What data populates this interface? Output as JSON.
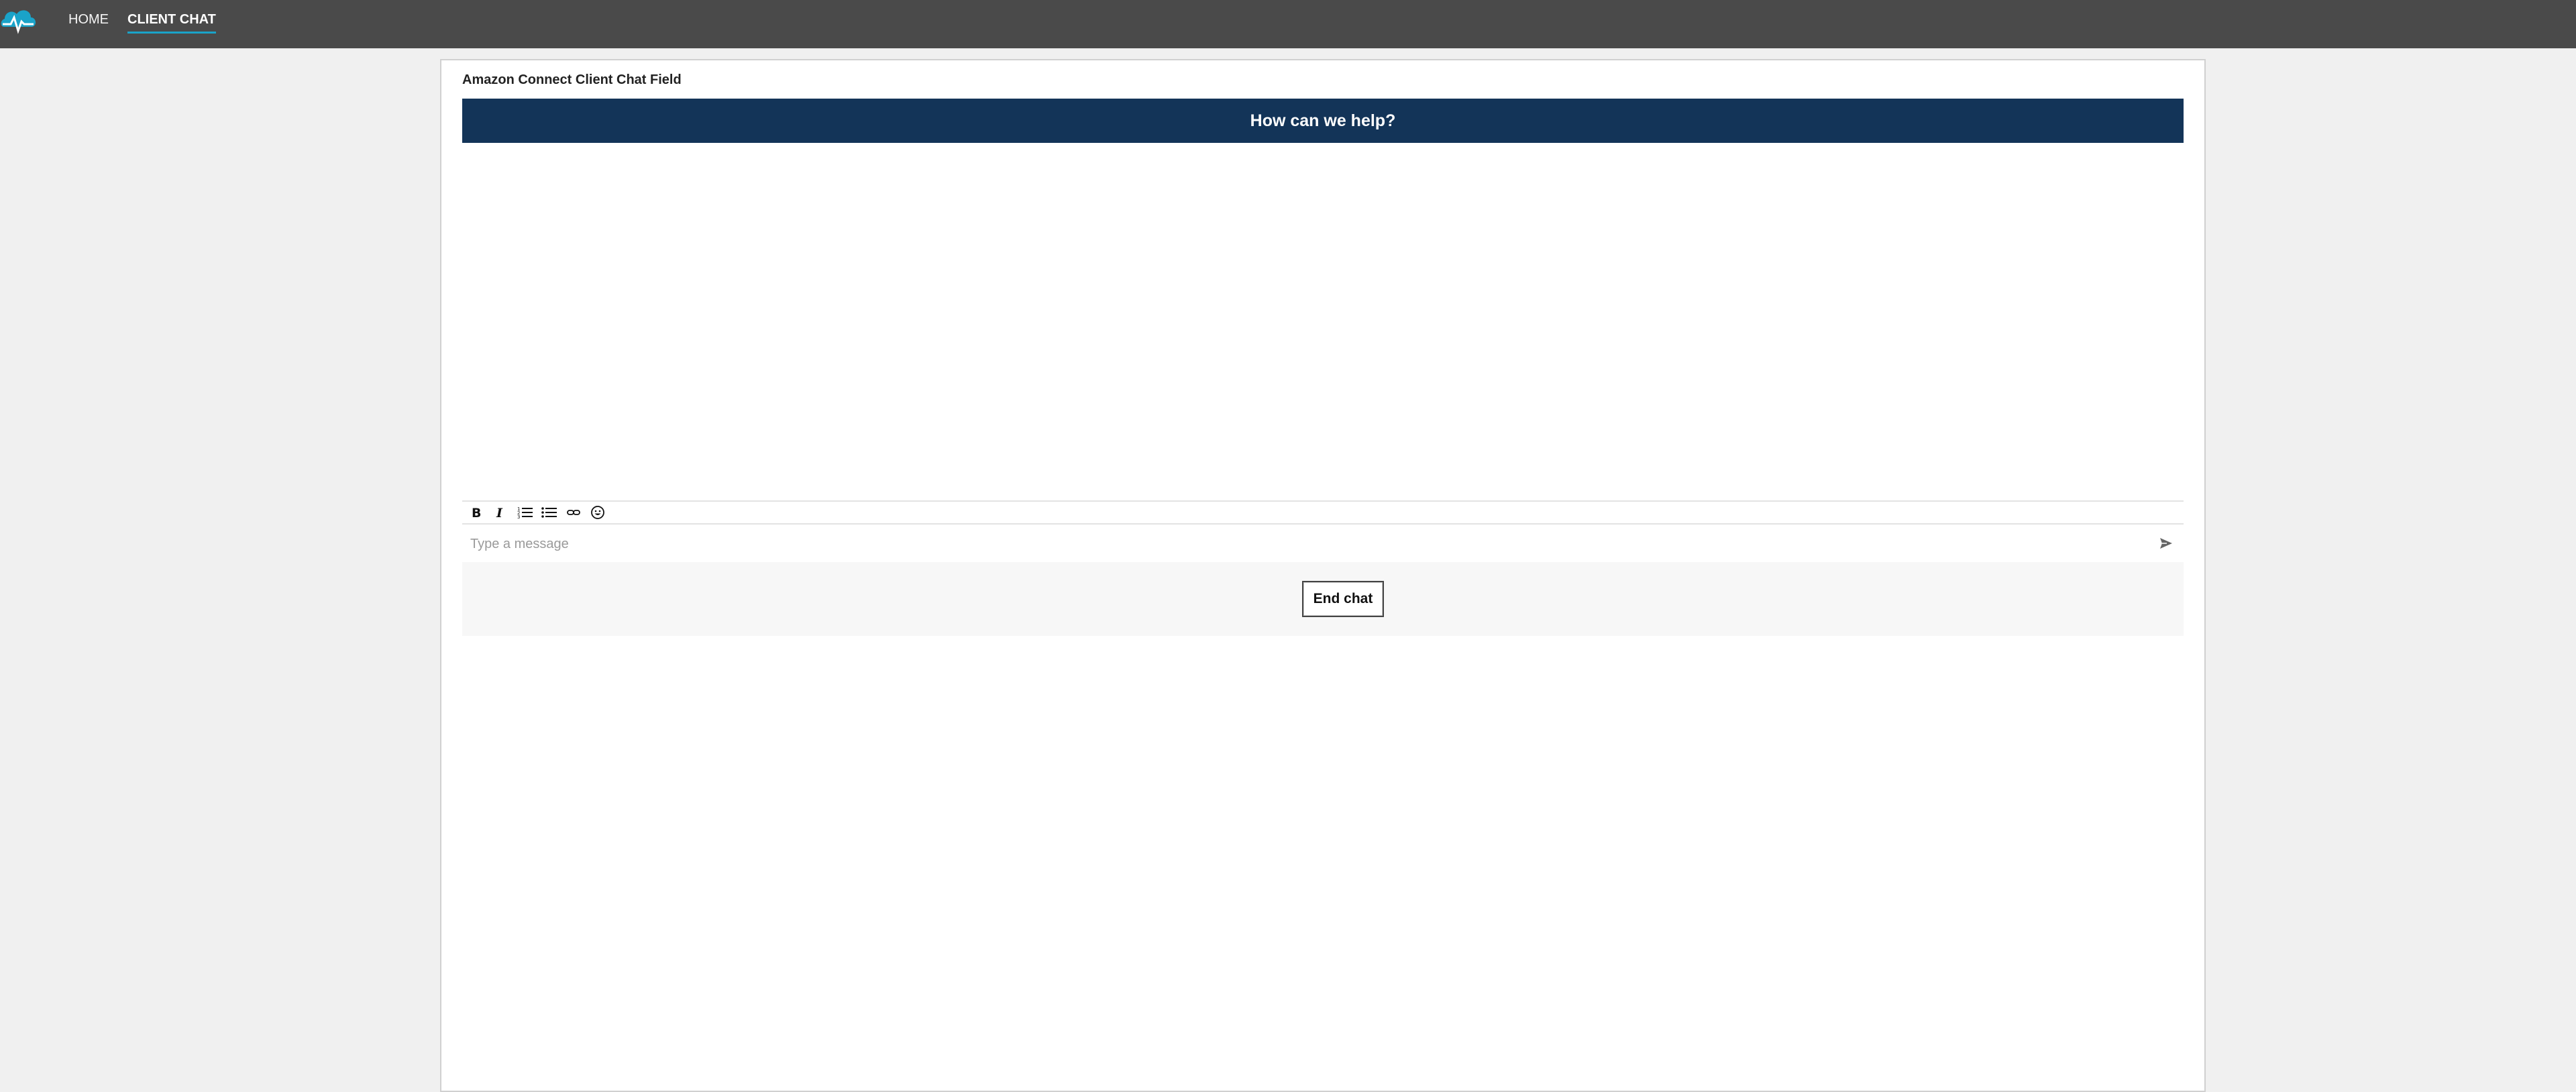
{
  "nav": {
    "logo_icon": "cloud-pulse-logo-icon",
    "home_label": "HOME",
    "client_chat_label": "CLIENT CHAT",
    "active": "CLIENT CHAT",
    "accent_color": "#1aa3c9",
    "bar_color": "#4a4a4a"
  },
  "panel": {
    "title": "Amazon Connect Client Chat Field"
  },
  "chat": {
    "header_title": "How can we help?",
    "header_color": "#133458",
    "toolbar": [
      "bold-icon",
      "italic-icon",
      "numbered-list-icon",
      "bulleted-list-icon",
      "link-icon",
      "emoji-icon"
    ],
    "input_placeholder": "Type a message",
    "input_value": "",
    "send_icon": "send-icon",
    "end_chat_label": "End chat"
  }
}
